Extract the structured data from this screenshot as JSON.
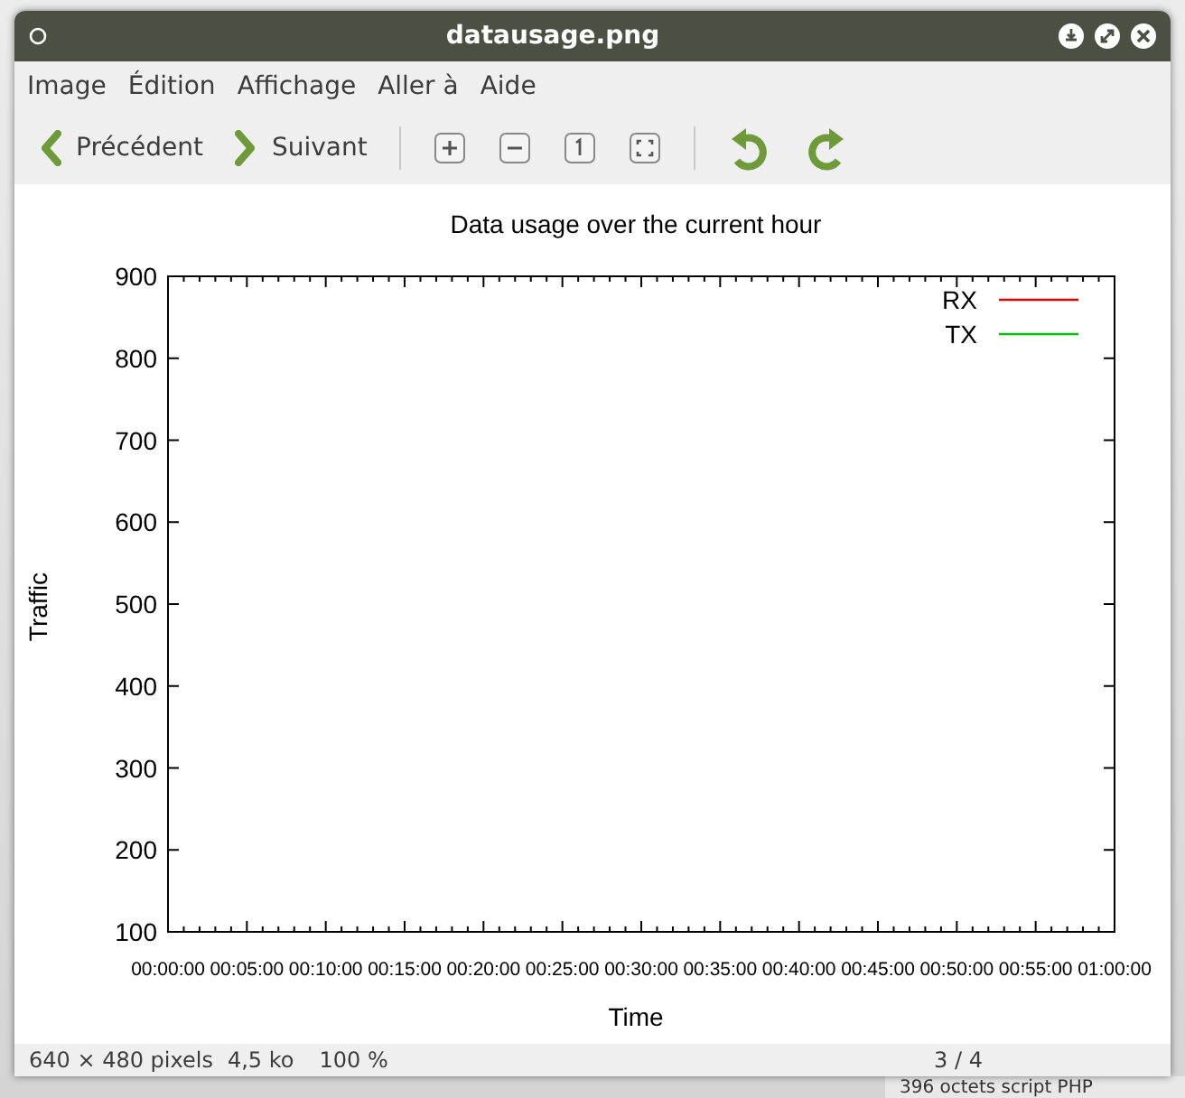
{
  "window": {
    "title": "datausage.png"
  },
  "menu": [
    "Image",
    "Édition",
    "Affichage",
    "Aller à",
    "Aide"
  ],
  "toolbar": {
    "navigation": [
      {
        "label": "Précédent"
      },
      {
        "label": "Suivant"
      }
    ]
  },
  "image": {
    "chart_data": {
      "type": "line",
      "title": "Data usage over the current hour",
      "xlabel": "Time",
      "ylabel": "Traffic",
      "x": [
        "00:00:00",
        "00:05:00",
        "00:10:00",
        "00:15:00",
        "00:20:00",
        "00:25:00",
        "00:30:00",
        "00:35:00",
        "00:40:00",
        "00:45:00",
        "00:50:00",
        "00:55:00",
        "01:00:00"
      ],
      "series": [
        {
          "name": "RX",
          "color": "#e00000",
          "values": [
            null,
            null,
            null,
            null,
            null,
            null,
            null,
            null,
            null,
            null,
            null,
            null,
            null
          ]
        },
        {
          "name": "TX",
          "color": "#00c000",
          "values": [
            null,
            null,
            null,
            null,
            null,
            null,
            null,
            null,
            null,
            null,
            null,
            null,
            null
          ]
        }
      ],
      "ylim": [
        100,
        900
      ],
      "yticks": [
        100,
        200,
        300,
        400,
        500,
        600,
        700,
        800,
        900
      ]
    }
  },
  "status_bar": {
    "dimensions": "640 × 480 pixels",
    "size": "4,5 ko",
    "zoom": "100 %",
    "position": "3 / 4"
  },
  "background": {
    "text": "396 octets  script PHP"
  }
}
